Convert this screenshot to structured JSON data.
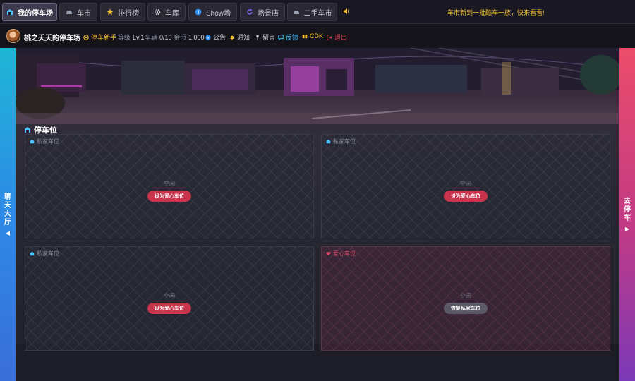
{
  "nav": {
    "tabs": [
      {
        "label": "我的停车场",
        "icon": "garage-icon",
        "active": true
      },
      {
        "label": "车市",
        "icon": "car-icon"
      },
      {
        "label": "排行榜",
        "icon": "star-icon"
      },
      {
        "label": "车库",
        "icon": "gear-icon"
      },
      {
        "label": "Show场",
        "icon": "info-icon"
      },
      {
        "label": "场景店",
        "icon": "refresh-icon"
      },
      {
        "label": "二手车市",
        "icon": "car-icon"
      }
    ],
    "announcement": "车市新到一批酷车一族，快来看看!"
  },
  "user": {
    "name": "桃之夭夭的停车场",
    "rank": "停车新手",
    "level_label": "等级",
    "level_value": "Lv.1",
    "cars_label": "车辆",
    "cars_value": "0/10",
    "coins_label": "金币",
    "coins_value": "1,000"
  },
  "links": {
    "notice": "公告",
    "inform": "通知",
    "message": "留言",
    "feedback": "反馈",
    "cdk": "CDK",
    "logout": "退出"
  },
  "sidebar": {
    "left": "聊天大厅",
    "right": "去停车"
  },
  "section": {
    "title": "停车位"
  },
  "slots": [
    {
      "type": "私家车位",
      "status": "空闲",
      "button": "设为爱心车位"
    },
    {
      "type": "私家车位",
      "status": "空闲",
      "button": "设为爱心车位"
    },
    {
      "type": "私家车位",
      "status": "空闲",
      "button": "设为爱心车位"
    },
    {
      "type": "爱心车位",
      "status": "空闲",
      "button": "恢复私家车位"
    }
  ],
  "colors": {
    "accent": "#c8344c",
    "gold": "#f2c12e",
    "love": "#d84a6a"
  }
}
